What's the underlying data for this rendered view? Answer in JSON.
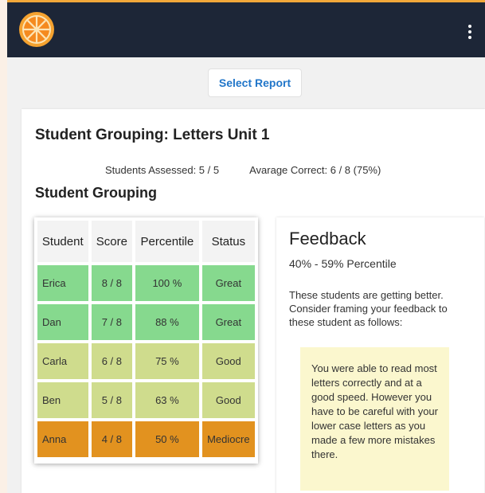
{
  "header": {
    "logo": "orange-slice-logo",
    "menu_icon": "kebab-menu-icon",
    "colors": {
      "bar": "#1d2637",
      "accent": "#f1a83a"
    }
  },
  "toolbar": {
    "select_report_label": "Select Report"
  },
  "report": {
    "title": "Student Grouping: Letters Unit 1",
    "students_assessed": "Students Assessed: 5 / 5",
    "average_correct": "Avarage Correct: 6 / 8 (75%)",
    "section_title": "Student Grouping"
  },
  "table": {
    "headers": [
      "Student",
      "Score",
      "Percentile",
      "Status"
    ],
    "rows": [
      {
        "student": "Erica",
        "score": "8 / 8",
        "percentile": "100 %",
        "status": "Great",
        "color": "#86d98e"
      },
      {
        "student": "Dan",
        "score": "7 / 8",
        "percentile": "88 %",
        "status": "Great",
        "color": "#86d98e"
      },
      {
        "student": "Carla",
        "score": "6 / 8",
        "percentile": "75 %",
        "status": "Good",
        "color": "#cfdc8d"
      },
      {
        "student": "Ben",
        "score": "5 / 8",
        "percentile": "63 %",
        "status": "Good",
        "color": "#cfdc8d"
      },
      {
        "student": "Anna",
        "score": "4 / 8",
        "percentile": "50 %",
        "status": "Mediocre",
        "color": "#e2921f"
      }
    ]
  },
  "feedback": {
    "title": "Feedback",
    "range": "40% - 59% Percentile",
    "intro": "These students are getting better. Consider framing your feedback to these student as follows:",
    "suggestion": "You were able to read most letters correctly and at a good speed. However you have to be careful with your lower case letters as you made a few more mistakes there."
  }
}
